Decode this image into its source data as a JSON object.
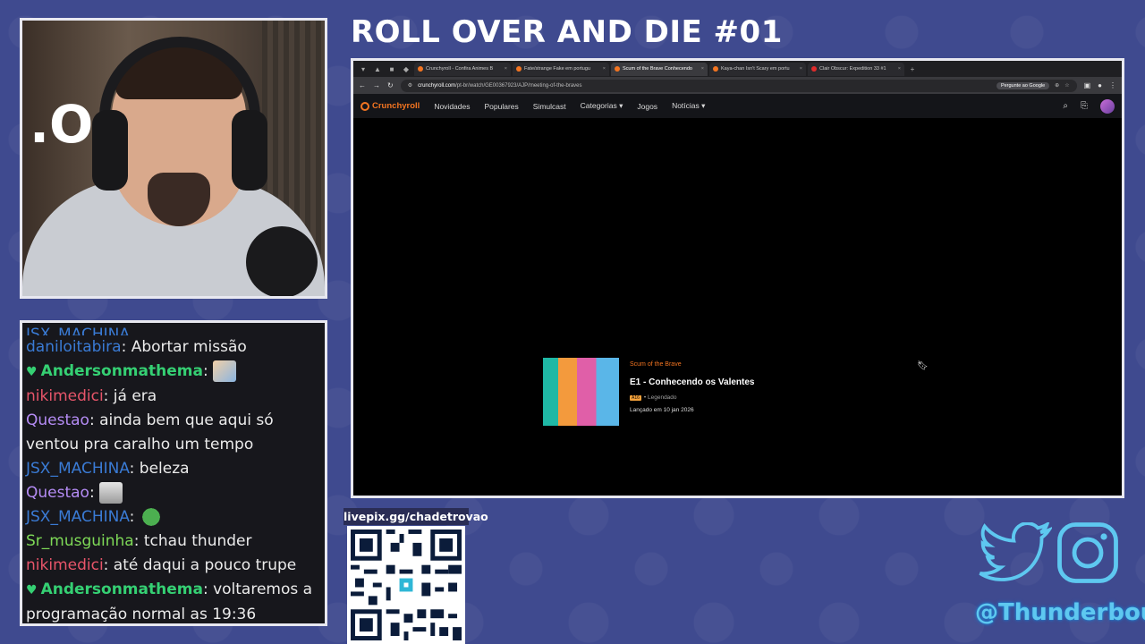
{
  "stream": {
    "title": "ROLL OVER AND DIE #01",
    "livepix_label": "livepix.gg/chadetrovao",
    "social_handle": "@Thunderbout"
  },
  "webcam": {
    "overlay_glyph": ".O"
  },
  "chat": {
    "lines": [
      {
        "user": "JSX_MACHINA",
        "user_color": "#3a7bd5",
        "message": ""
      },
      {
        "user": "daniloitabira",
        "user_color": "#3a7bd5",
        "message": ": Abortar missão"
      },
      {
        "user": "Andersonmathema",
        "user_color": "#35d073",
        "message": ":"
      },
      {
        "user": "nikimedici",
        "user_color": "#e8556a",
        "message": ": já era"
      },
      {
        "user": "Questao",
        "user_color": "#b58cf5",
        "message": ": ainda bem que aqui só ventou pra caralho um tempo"
      },
      {
        "user": "JSX_MACHINA",
        "user_color": "#3a7bd5",
        "message": ": beleza"
      },
      {
        "user": "Questao",
        "user_color": "#b58cf5",
        "message": ":"
      },
      {
        "user": "JSX_MACHINA",
        "user_color": "#3a7bd5",
        "message": ":"
      },
      {
        "user": "Sr_musguinha",
        "user_color": "#7ed957",
        "message": ": tchau thunder"
      },
      {
        "user": "nikimedici",
        "user_color": "#e8556a",
        "message": ": até daqui a pouco trupe"
      },
      {
        "user": "Andersonmathema",
        "user_color": "#35d073",
        "message": ": voltaremos a programação normal as 19:36"
      }
    ]
  },
  "browser": {
    "tabs": [
      {
        "label": "Crunchyroll - Confira Animes B",
        "active": false
      },
      {
        "label": "Fate/strange Fake em portugu",
        "active": false
      },
      {
        "label": "Scum of the Brave Conhecendo",
        "active": true
      },
      {
        "label": "Kaya-chan Isn't Scary em portu",
        "active": false
      },
      {
        "label": "Clair Obscur: Expedition 33 #1",
        "active": false
      }
    ],
    "url_host": "crunchyroll.com",
    "url_path": "/pt-br/watch/GE00367923/AJP/meeting-of-the-braves",
    "ask_google": "Pergunte ao Google",
    "nav": {
      "logo": "Crunchyroll",
      "items": [
        "Novidades",
        "Populares",
        "Simulcast",
        "Categorias",
        "Jogos",
        "Notícias"
      ]
    },
    "episode": {
      "show": "Scum of the Brave",
      "title": "E1 - Conhecendo os Valentes",
      "rating": "A16",
      "subtitle": "• Legendado",
      "date": "Lançado em 10 jan 2026"
    }
  },
  "colors": {
    "background": "#3f4a8f",
    "crunchyroll_orange": "#f47521",
    "handle_blue": "#5ec8f0"
  }
}
